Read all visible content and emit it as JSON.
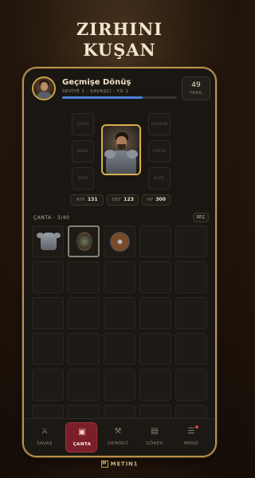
{
  "headline": {
    "line1": "ZIRHINI",
    "line2": "KUŞAN"
  },
  "profile": {
    "name": "Geçmişe Dönüş",
    "subtitle": "SEVİYE 1 · SAVAŞÇI · YD 1",
    "xp_fraction": 0.7,
    "currency_value": "49",
    "currency_label": "YANG"
  },
  "equipment": {
    "left_slots": [
      "SİLAH",
      "KASK",
      "ZIRH"
    ],
    "right_slots": [
      "KALKAN",
      "YÜZÜK",
      "KUPE"
    ],
    "stats": [
      {
        "key": "ATK",
        "value": "131"
      },
      {
        "key": "DEF",
        "value": "123"
      },
      {
        "key": "HP",
        "value": "300"
      }
    ]
  },
  "inventory": {
    "title": "ÇANTA · 3/40",
    "sort_label": "SEÇ",
    "items": [
      "armor",
      "amulet",
      "shield"
    ]
  },
  "nav": [
    {
      "label": "SAVAŞ",
      "icon": "crossed-swords-icon",
      "glyph": "⚔"
    },
    {
      "label": "ÇANTA",
      "icon": "bag-icon",
      "glyph": "▣",
      "active": true
    },
    {
      "label": "DEMİRCİ",
      "icon": "anvil-icon",
      "glyph": "⚒"
    },
    {
      "label": "GÖREV",
      "icon": "scroll-icon",
      "glyph": "▤"
    },
    {
      "label": "MENÜ",
      "icon": "menu-icon",
      "glyph": "☰",
      "badge": true
    }
  ],
  "brand": {
    "logo_letter": "M",
    "name": "METIN1"
  },
  "colors": {
    "accent_gold": "#c9a04a",
    "active_tab": "#7a1f2a",
    "xp_blue": "#4a7fd8"
  }
}
